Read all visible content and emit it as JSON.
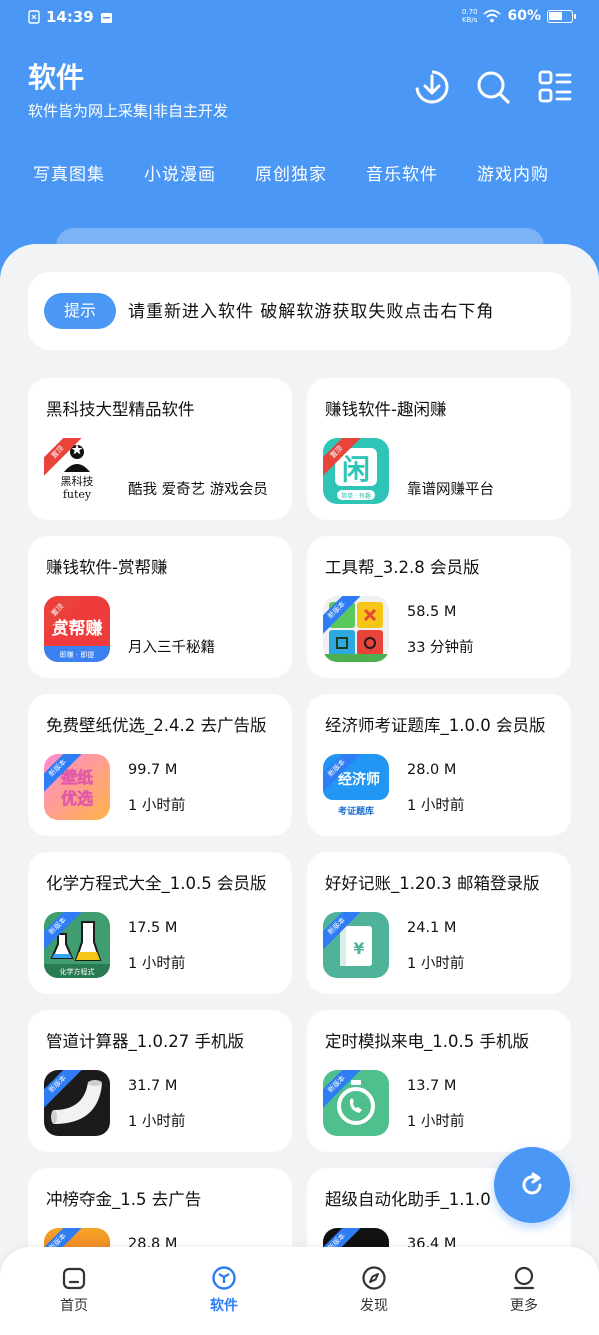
{
  "status_bar": {
    "time": "14:39",
    "net_speed_top": "0.70",
    "net_speed_bottom": "KB/s",
    "battery": "60%"
  },
  "header": {
    "title": "软件",
    "subtitle": "软件皆为网上采集|非自主开发",
    "categories": [
      "写真图集",
      "小说漫画",
      "原创独家",
      "音乐软件",
      "游戏内购"
    ]
  },
  "notice": {
    "badge": "提示",
    "text": "请重新进入软件   破解软游获取失败点击右下角"
  },
  "cards": [
    {
      "title": "黑科技大型精品软件",
      "desc": "酷我 爱奇艺 游戏会员",
      "icon_badge": "置顶",
      "icon": "futey-icon",
      "icon_text": "黑科技",
      "icon_sub": "futey"
    },
    {
      "title": "赚钱软件-趣闲赚",
      "desc": "靠谱网赚平台",
      "icon_badge": "置顶",
      "icon": "xian-icon",
      "icon_text": "闲",
      "icon_sub": "简单 · 有趣"
    },
    {
      "title": "赚钱软件-赏帮赚",
      "desc": "月入三千秘籍",
      "icon_badge": "置顶",
      "icon": "shangbang-icon",
      "icon_text": "赏帮赚",
      "icon_sub": "即赚 · 即提"
    },
    {
      "title": "工具帮_3.2.8 会员版",
      "size": "58.5 M",
      "time": "33 分钟前",
      "icon_badge": "新版本",
      "icon": "toolbox-icon"
    },
    {
      "title": "免费壁纸优选_2.4.2 去广告版",
      "size": "99.7 M",
      "time": "1 小时前",
      "icon_badge": "新版本",
      "icon": "wallpaper-icon",
      "icon_text": "壁纸优选"
    },
    {
      "title": "经济师考证题库_1.0.0 会员版",
      "size": "28.0 M",
      "time": "1 小时前",
      "icon_badge": "新版本",
      "icon": "economist-icon",
      "icon_text": "经济师",
      "icon_sub": "考证题库"
    },
    {
      "title": "化学方程式大全_1.0.5 会员版",
      "size": "17.5 M",
      "time": "1 小时前",
      "icon_badge": "新版本",
      "icon": "chemistry-icon",
      "icon_sub": "化学方程式"
    },
    {
      "title": "好好记账_1.20.3 邮箱登录版",
      "size": "24.1 M",
      "time": "1 小时前",
      "icon_badge": "新版本",
      "icon": "ledger-icon"
    },
    {
      "title": "管道计算器_1.0.27 手机版",
      "size": "31.7 M",
      "time": "1 小时前",
      "icon_badge": "新版本",
      "icon": "pipe-icon"
    },
    {
      "title": "定时模拟来电_1.0.5 手机版",
      "size": "13.7 M",
      "time": "1 小时前",
      "icon_badge": "新版本",
      "icon": "fake-call-icon"
    },
    {
      "title": "冲榜夺金_1.5 去广告",
      "size": "28.8 M",
      "icon_badge": "新版本",
      "icon": "rank-gold-icon"
    },
    {
      "title": "超级自动化助手_1.1.0",
      "size": "36.4 M",
      "icon_badge": "新版本",
      "icon": "automation-icon"
    }
  ],
  "bottom_nav": [
    {
      "label": "首页",
      "icon": "home-icon"
    },
    {
      "label": "软件",
      "icon": "software-icon",
      "active": true
    },
    {
      "label": "发现",
      "icon": "compass-icon"
    },
    {
      "label": "更多",
      "icon": "user-icon"
    }
  ],
  "colors": {
    "primary": "#4a97f5",
    "background": "#f2f3f5",
    "card": "#ffffff"
  }
}
